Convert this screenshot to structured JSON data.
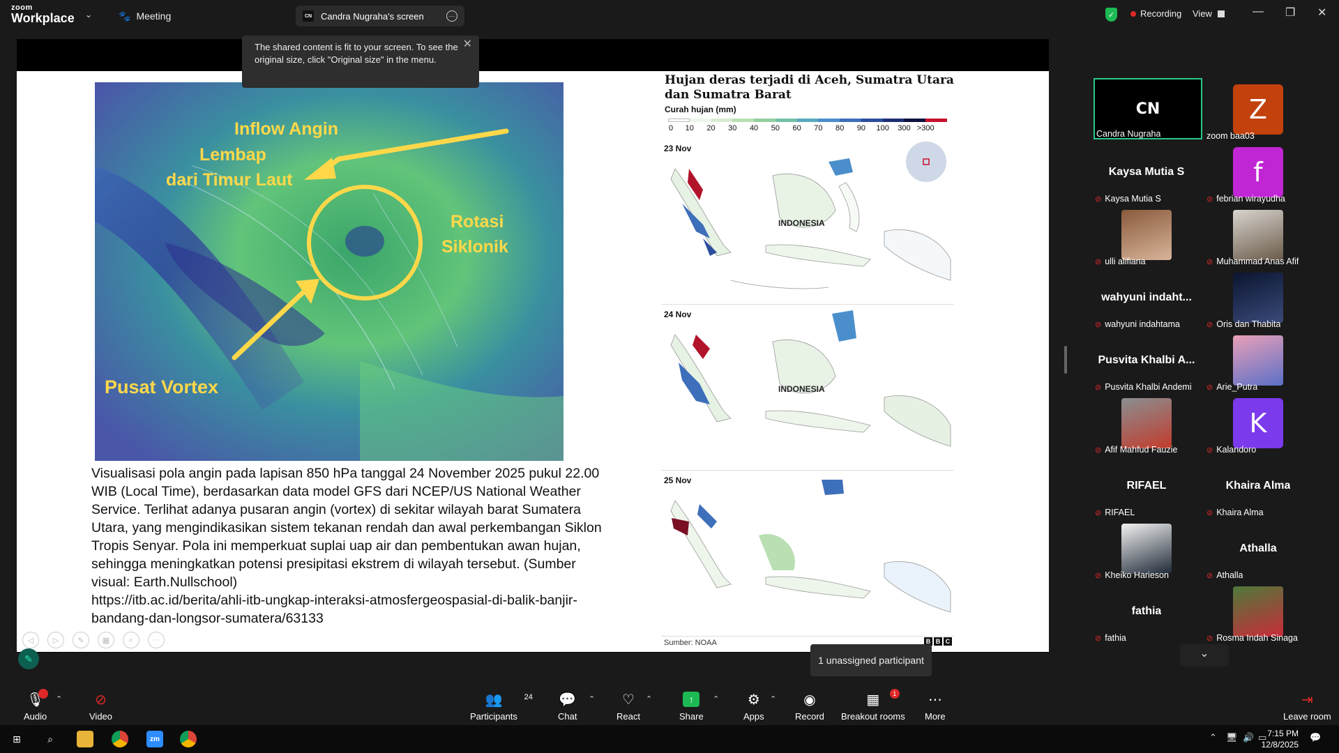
{
  "app": {
    "logo_top": "zoom",
    "logo_bottom": "Workplace",
    "meeting_label": "Meeting"
  },
  "share_pill": {
    "initials": "CN",
    "title": "Candra Nugraha's screen"
  },
  "toast": {
    "text": "The shared content is fit to your screen. To see the original size, click \"Original size\" in the menu."
  },
  "status": {
    "recording": "Recording",
    "view": "View"
  },
  "slide": {
    "caption": "Visualisasi pola angin pada lapisan 850 hPa tanggal 24 November 2025 pukul 22.00 WIB (Local Time), berdasarkan data model GFS dari NCEP/US National Weather Service. Terlihat adanya pusaran angin (vortex) di sekitar wilayah barat Sumatera Utara, yang mengindikasikan sistem tekanan rendah dan awal perkembangan Siklon Tropis Senyar. Pola ini memperkuat suplai uap air dan pembentukan awan hujan, sehingga meningkatkan potensi presipitasi ekstrem di wilayah tersebut. (Sumber visual: Earth.Nullschool)",
    "link": "https://itb.ac.id/berita/ahli-itb-ungkap-interaksi-atmosfergeospasial-di-balik-banjir-bandang-dan-longsor-sumatera/63133",
    "wind": {
      "inflow1": "Inflow Angin",
      "inflow2": "Lembap",
      "inflow3": "dari Timur Laut",
      "rot1": "Rotasi",
      "rot2": "Siklonik",
      "vortex": "Pusat Vortex"
    },
    "map": {
      "title": "Hujan deras terjadi di Aceh, Sumatra Utara dan Sumatra Barat",
      "subtitle": "Curah hujan (mm)",
      "legend": [
        "0",
        "10",
        "20",
        "30",
        "40",
        "50",
        "60",
        "70",
        "80",
        "90",
        "100",
        "300",
        ">300"
      ],
      "legend_colors": [
        "#ffffff",
        "#eef6ec",
        "#d7ecd2",
        "#b9dfb3",
        "#95cfa0",
        "#74bfa8",
        "#5aa9bf",
        "#4a8fcb",
        "#3d6fba",
        "#2c4f9d",
        "#1d2f74",
        "#0d1240",
        "#c8102e"
      ],
      "days": [
        "23 Nov",
        "24 Nov",
        "25 Nov"
      ],
      "country": "INDONESIA",
      "source": "Sumber: NOAA",
      "bbc": [
        "B",
        "B",
        "C"
      ]
    }
  },
  "participants": [
    {
      "name": "Candra Nugraha",
      "initials": "CN",
      "bg": "#000000",
      "type": "avatar",
      "muted": false,
      "active": true
    },
    {
      "name": "zoom baa03",
      "initials": "Z",
      "bg": "#c2410c",
      "type": "avatar",
      "muted": false
    },
    {
      "name": "Kaysa Mutia S",
      "big": "Kaysa Mutia S",
      "type": "name",
      "muted": true
    },
    {
      "name": "febrian wirayudha",
      "initials": "f",
      "bg": "#c026d3",
      "type": "avatar",
      "muted": true
    },
    {
      "name": "ulli alifiana",
      "type": "photo",
      "muted": true,
      "c1": "#8a5a3c",
      "c2": "#d8b49a"
    },
    {
      "name": "Muhammad Anas Afif",
      "type": "photo",
      "muted": true,
      "c1": "#d8d4ce",
      "c2": "#6b5b4a"
    },
    {
      "name": "wahyuni indahtama",
      "big": "wahyuni  indaht...",
      "type": "name",
      "muted": true
    },
    {
      "name": "Oris dan Thabita",
      "type": "photo",
      "muted": true,
      "c1": "#0b1530",
      "c2": "#3a4a7a"
    },
    {
      "name": "Pusvita Khalbi Andemi",
      "big": "Pusvita Khalbi A...",
      "type": "name",
      "muted": true
    },
    {
      "name": "Arie_Putra",
      "type": "photo",
      "muted": true,
      "c1": "#e9a0b8",
      "c2": "#5b6fc7"
    },
    {
      "name": "Afif Mahfud Fauzie",
      "type": "photo",
      "muted": true,
      "c1": "#8a8f92",
      "c2": "#c23b2b"
    },
    {
      "name": "Kalandoro",
      "initials": "K",
      "bg": "#7c3aed",
      "type": "avatar",
      "muted": true
    },
    {
      "name": "RIFAEL",
      "big": "RIFAEL",
      "type": "name",
      "muted": true
    },
    {
      "name": "Khaira Alma",
      "big": "Khaira Alma",
      "type": "name",
      "muted": true
    },
    {
      "name": "Kheiko Harieson",
      "type": "photo",
      "muted": true,
      "c1": "#f2f2f2",
      "c2": "#1f2937"
    },
    {
      "name": "Athalla",
      "big": "Athalla",
      "type": "name",
      "muted": true
    },
    {
      "name": "fathia",
      "big": "fathia",
      "type": "name",
      "muted": true
    },
    {
      "name": "Rosma Indah Sinaga",
      "type": "photo",
      "muted": true,
      "c1": "#4e7a3a",
      "c2": "#c92b3a"
    }
  ],
  "tooltip": "1 unassigned participant",
  "toolbar": {
    "audio": "Audio",
    "video": "Video",
    "participants": "Participants",
    "participants_count": "24",
    "chat": "Chat",
    "react": "React",
    "share": "Share",
    "apps": "Apps",
    "record": "Record",
    "breakout": "Breakout rooms",
    "breakout_badge": "1",
    "more": "More",
    "leave": "Leave room"
  },
  "taskbar": {
    "time": "7:15 PM",
    "date": "12/8/2025"
  }
}
